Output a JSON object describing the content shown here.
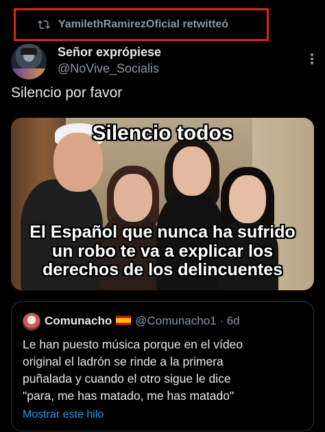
{
  "retweet": {
    "label": "YamilethRamirezOficial retwitteó",
    "icon": "retweet-icon",
    "highlight_color": "#e0231b"
  },
  "author": {
    "display_name": "Señor exprópiese",
    "handle": "@NoVive_Socialis"
  },
  "tweet": {
    "text": "Silencio por favor"
  },
  "media": {
    "top_text": "Silencio todos",
    "bottom_lines": [
      "El Español que nunca ha sufrido",
      "un robo te va a explicar los",
      "derechos de los delincuentes"
    ]
  },
  "quote": {
    "name": "Comunacho",
    "flag": "spain-flag",
    "handle_time": "@Comunacho1 · 6d",
    "lines": [
      "Le han puesto música porque en el vídeo",
      "original el ladrón se rinde a la primera",
      "puñalada y cuando el otro sigue le dice",
      "\"para, me has matado, me has matado\""
    ],
    "show_thread": "Mostrar este hilo"
  },
  "colors": {
    "background": "#000000",
    "text": "#e7e9ea",
    "muted": "#8b98a5",
    "link": "#1d9bf0"
  }
}
